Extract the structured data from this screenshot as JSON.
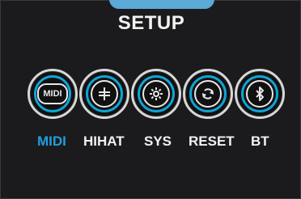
{
  "screen": {
    "title": "SETUP"
  },
  "colors": {
    "accent": "#1e9fe0",
    "ring": "#0ea5d8",
    "background": "#1b1b1d",
    "text": "#f2f2f2"
  },
  "menu": {
    "items": [
      {
        "id": "midi",
        "label": "MIDI",
        "icon": "midi-text-icon",
        "active": true,
        "icon_text": "MIDI"
      },
      {
        "id": "hihat",
        "label": "HIHAT",
        "icon": "hihat-icon",
        "active": false
      },
      {
        "id": "sys",
        "label": "SYS",
        "icon": "gear-icon",
        "active": false
      },
      {
        "id": "reset",
        "label": "RESET",
        "icon": "reset-icon",
        "active": false
      },
      {
        "id": "bt",
        "label": "BT",
        "icon": "bluetooth-icon",
        "active": false
      }
    ]
  }
}
